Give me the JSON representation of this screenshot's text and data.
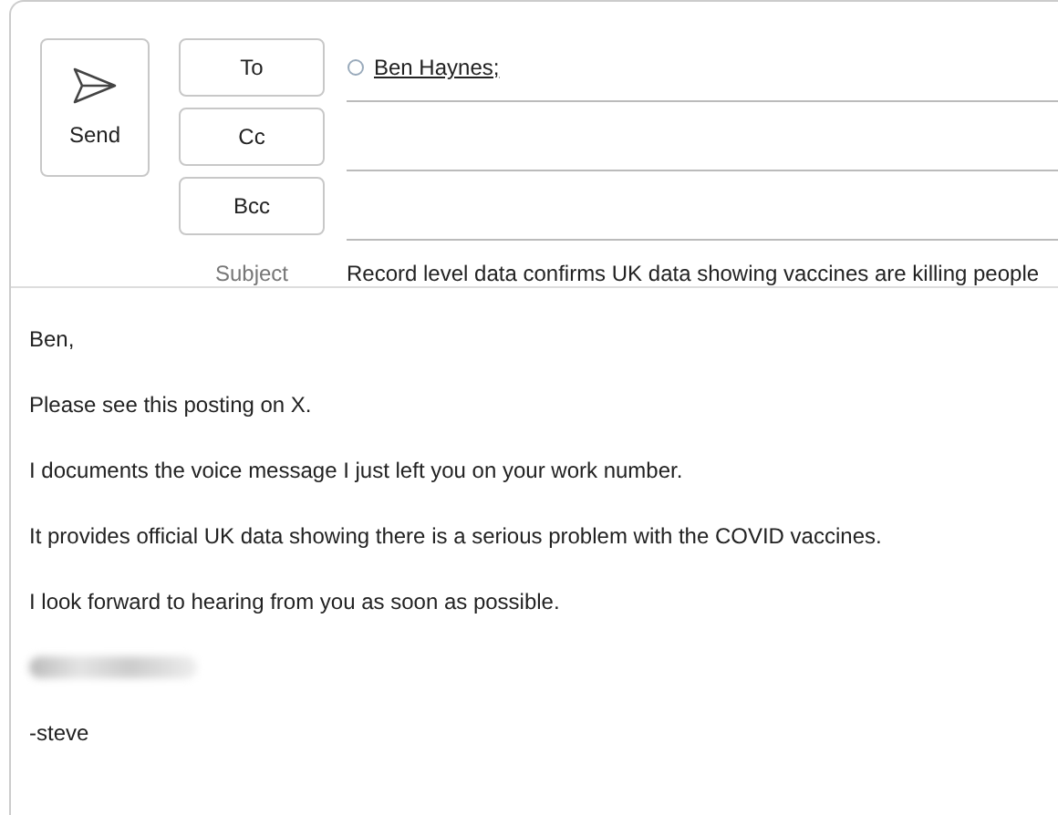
{
  "send_button": {
    "label": "Send"
  },
  "address_buttons": [
    "To",
    "Cc",
    "Bcc"
  ],
  "recipients": {
    "to": [
      {
        "name": "Ben Haynes;"
      }
    ]
  },
  "subject": {
    "label": "Subject",
    "value": "Record level data confirms UK data showing vaccines are killing people"
  },
  "body": [
    {
      "kind": "text",
      "text": "Ben,"
    },
    {
      "kind": "text",
      "text": "Please see this posting on X."
    },
    {
      "kind": "text",
      "text": "I documents the voice message I just left you on your work number."
    },
    {
      "kind": "text",
      "text": "It provides official UK data showing there is a serious problem with the COVID vaccines."
    },
    {
      "kind": "text",
      "text": "I look forward to hearing from you as soon as possible."
    },
    {
      "kind": "redacted"
    },
    {
      "kind": "text",
      "text": "-steve"
    }
  ]
}
